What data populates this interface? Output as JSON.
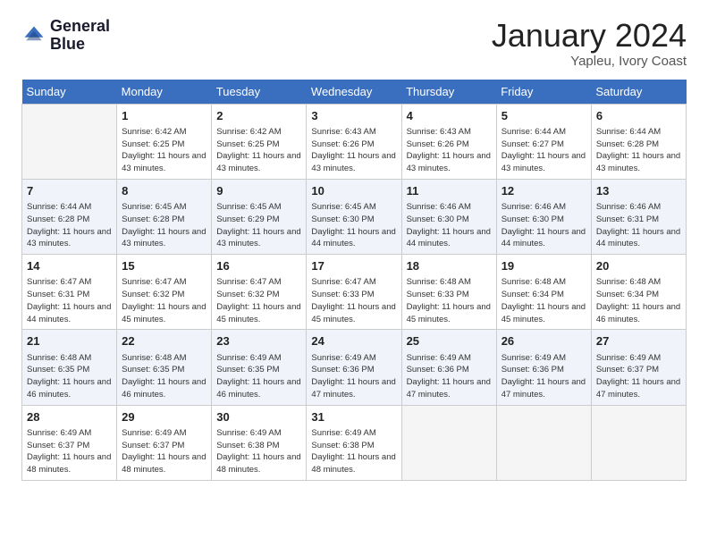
{
  "logo": {
    "line1": "General",
    "line2": "Blue"
  },
  "title": "January 2024",
  "subtitle": "Yapleu, Ivory Coast",
  "weekdays": [
    "Sunday",
    "Monday",
    "Tuesday",
    "Wednesday",
    "Thursday",
    "Friday",
    "Saturday"
  ],
  "weeks": [
    [
      {
        "day": "",
        "sunrise": "",
        "sunset": "",
        "daylight": ""
      },
      {
        "day": "1",
        "sunrise": "Sunrise: 6:42 AM",
        "sunset": "Sunset: 6:25 PM",
        "daylight": "Daylight: 11 hours and 43 minutes."
      },
      {
        "day": "2",
        "sunrise": "Sunrise: 6:42 AM",
        "sunset": "Sunset: 6:25 PM",
        "daylight": "Daylight: 11 hours and 43 minutes."
      },
      {
        "day": "3",
        "sunrise": "Sunrise: 6:43 AM",
        "sunset": "Sunset: 6:26 PM",
        "daylight": "Daylight: 11 hours and 43 minutes."
      },
      {
        "day": "4",
        "sunrise": "Sunrise: 6:43 AM",
        "sunset": "Sunset: 6:26 PM",
        "daylight": "Daylight: 11 hours and 43 minutes."
      },
      {
        "day": "5",
        "sunrise": "Sunrise: 6:44 AM",
        "sunset": "Sunset: 6:27 PM",
        "daylight": "Daylight: 11 hours and 43 minutes."
      },
      {
        "day": "6",
        "sunrise": "Sunrise: 6:44 AM",
        "sunset": "Sunset: 6:28 PM",
        "daylight": "Daylight: 11 hours and 43 minutes."
      }
    ],
    [
      {
        "day": "7",
        "sunrise": "Sunrise: 6:44 AM",
        "sunset": "Sunset: 6:28 PM",
        "daylight": "Daylight: 11 hours and 43 minutes."
      },
      {
        "day": "8",
        "sunrise": "Sunrise: 6:45 AM",
        "sunset": "Sunset: 6:28 PM",
        "daylight": "Daylight: 11 hours and 43 minutes."
      },
      {
        "day": "9",
        "sunrise": "Sunrise: 6:45 AM",
        "sunset": "Sunset: 6:29 PM",
        "daylight": "Daylight: 11 hours and 43 minutes."
      },
      {
        "day": "10",
        "sunrise": "Sunrise: 6:45 AM",
        "sunset": "Sunset: 6:30 PM",
        "daylight": "Daylight: 11 hours and 44 minutes."
      },
      {
        "day": "11",
        "sunrise": "Sunrise: 6:46 AM",
        "sunset": "Sunset: 6:30 PM",
        "daylight": "Daylight: 11 hours and 44 minutes."
      },
      {
        "day": "12",
        "sunrise": "Sunrise: 6:46 AM",
        "sunset": "Sunset: 6:30 PM",
        "daylight": "Daylight: 11 hours and 44 minutes."
      },
      {
        "day": "13",
        "sunrise": "Sunrise: 6:46 AM",
        "sunset": "Sunset: 6:31 PM",
        "daylight": "Daylight: 11 hours and 44 minutes."
      }
    ],
    [
      {
        "day": "14",
        "sunrise": "Sunrise: 6:47 AM",
        "sunset": "Sunset: 6:31 PM",
        "daylight": "Daylight: 11 hours and 44 minutes."
      },
      {
        "day": "15",
        "sunrise": "Sunrise: 6:47 AM",
        "sunset": "Sunset: 6:32 PM",
        "daylight": "Daylight: 11 hours and 45 minutes."
      },
      {
        "day": "16",
        "sunrise": "Sunrise: 6:47 AM",
        "sunset": "Sunset: 6:32 PM",
        "daylight": "Daylight: 11 hours and 45 minutes."
      },
      {
        "day": "17",
        "sunrise": "Sunrise: 6:47 AM",
        "sunset": "Sunset: 6:33 PM",
        "daylight": "Daylight: 11 hours and 45 minutes."
      },
      {
        "day": "18",
        "sunrise": "Sunrise: 6:48 AM",
        "sunset": "Sunset: 6:33 PM",
        "daylight": "Daylight: 11 hours and 45 minutes."
      },
      {
        "day": "19",
        "sunrise": "Sunrise: 6:48 AM",
        "sunset": "Sunset: 6:34 PM",
        "daylight": "Daylight: 11 hours and 45 minutes."
      },
      {
        "day": "20",
        "sunrise": "Sunrise: 6:48 AM",
        "sunset": "Sunset: 6:34 PM",
        "daylight": "Daylight: 11 hours and 46 minutes."
      }
    ],
    [
      {
        "day": "21",
        "sunrise": "Sunrise: 6:48 AM",
        "sunset": "Sunset: 6:35 PM",
        "daylight": "Daylight: 11 hours and 46 minutes."
      },
      {
        "day": "22",
        "sunrise": "Sunrise: 6:48 AM",
        "sunset": "Sunset: 6:35 PM",
        "daylight": "Daylight: 11 hours and 46 minutes."
      },
      {
        "day": "23",
        "sunrise": "Sunrise: 6:49 AM",
        "sunset": "Sunset: 6:35 PM",
        "daylight": "Daylight: 11 hours and 46 minutes."
      },
      {
        "day": "24",
        "sunrise": "Sunrise: 6:49 AM",
        "sunset": "Sunset: 6:36 PM",
        "daylight": "Daylight: 11 hours and 47 minutes."
      },
      {
        "day": "25",
        "sunrise": "Sunrise: 6:49 AM",
        "sunset": "Sunset: 6:36 PM",
        "daylight": "Daylight: 11 hours and 47 minutes."
      },
      {
        "day": "26",
        "sunrise": "Sunrise: 6:49 AM",
        "sunset": "Sunset: 6:36 PM",
        "daylight": "Daylight: 11 hours and 47 minutes."
      },
      {
        "day": "27",
        "sunrise": "Sunrise: 6:49 AM",
        "sunset": "Sunset: 6:37 PM",
        "daylight": "Daylight: 11 hours and 47 minutes."
      }
    ],
    [
      {
        "day": "28",
        "sunrise": "Sunrise: 6:49 AM",
        "sunset": "Sunset: 6:37 PM",
        "daylight": "Daylight: 11 hours and 48 minutes."
      },
      {
        "day": "29",
        "sunrise": "Sunrise: 6:49 AM",
        "sunset": "Sunset: 6:37 PM",
        "daylight": "Daylight: 11 hours and 48 minutes."
      },
      {
        "day": "30",
        "sunrise": "Sunrise: 6:49 AM",
        "sunset": "Sunset: 6:38 PM",
        "daylight": "Daylight: 11 hours and 48 minutes."
      },
      {
        "day": "31",
        "sunrise": "Sunrise: 6:49 AM",
        "sunset": "Sunset: 6:38 PM",
        "daylight": "Daylight: 11 hours and 48 minutes."
      },
      {
        "day": "",
        "sunrise": "",
        "sunset": "",
        "daylight": ""
      },
      {
        "day": "",
        "sunrise": "",
        "sunset": "",
        "daylight": ""
      },
      {
        "day": "",
        "sunrise": "",
        "sunset": "",
        "daylight": ""
      }
    ]
  ]
}
